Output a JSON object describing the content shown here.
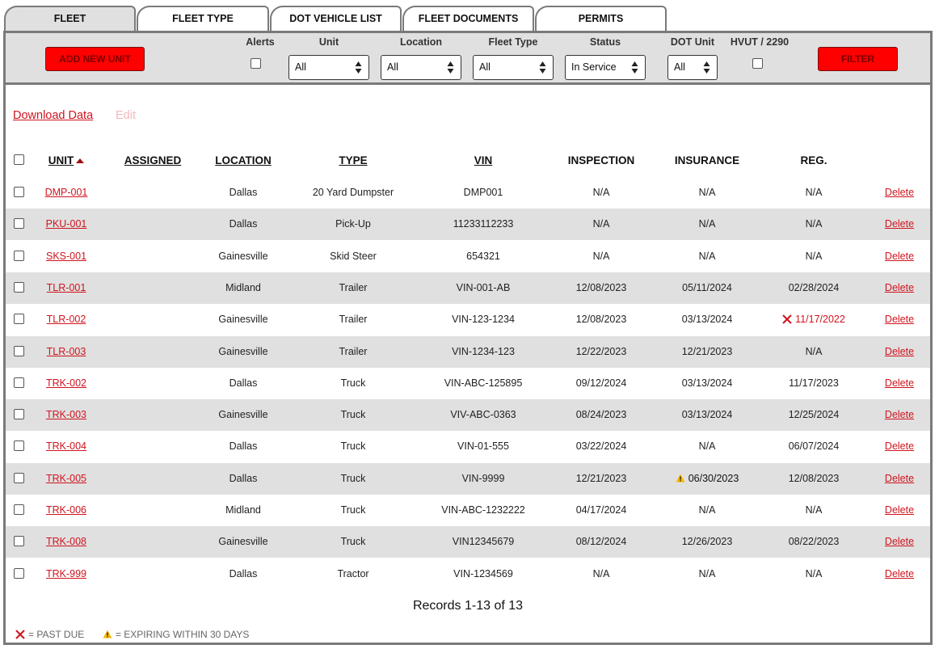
{
  "tabs": [
    {
      "label": "FLEET",
      "active": true
    },
    {
      "label": "FLEET TYPE",
      "active": false
    },
    {
      "label": "DOT VEHICLE LIST",
      "active": false
    },
    {
      "label": "FLEET DOCUMENTS",
      "active": false
    },
    {
      "label": "PERMITS",
      "active": false
    }
  ],
  "filters": {
    "add_button": "ADD NEW UNIT",
    "alerts_label": "Alerts",
    "unit": {
      "label": "Unit",
      "value": "All"
    },
    "location": {
      "label": "Location",
      "value": "All"
    },
    "fleet_type": {
      "label": "Fleet Type",
      "value": "All"
    },
    "status": {
      "label": "Status",
      "value": "In Service"
    },
    "dot_unit": {
      "label": "DOT Unit",
      "value": "All"
    },
    "hvut_label": "HVUT / 2290",
    "filter_button": "FILTER"
  },
  "actions": {
    "download": "Download Data",
    "edit": "Edit"
  },
  "table": {
    "headers": {
      "unit": "UNIT",
      "assigned": "ASSIGNED",
      "location": "LOCATION",
      "type": "TYPE",
      "vin": "VIN",
      "inspection": "INSPECTION",
      "insurance": "INSURANCE",
      "reg": "REG."
    },
    "delete_label": "Delete",
    "rows": [
      {
        "unit": "DMP-001",
        "assigned": "",
        "location": "Dallas",
        "type": "20 Yard Dumpster",
        "vin": "DMP001",
        "inspection": "N/A",
        "insurance": "N/A",
        "reg": "N/A",
        "reg_status": "",
        "insurance_status": ""
      },
      {
        "unit": "PKU-001",
        "assigned": "",
        "location": "Dallas",
        "type": "Pick-Up",
        "vin": "11233112233",
        "inspection": "N/A",
        "insurance": "N/A",
        "reg": "N/A",
        "reg_status": "",
        "insurance_status": ""
      },
      {
        "unit": "SKS-001",
        "assigned": "",
        "location": "Gainesville",
        "type": "Skid Steer",
        "vin": "654321",
        "inspection": "N/A",
        "insurance": "N/A",
        "reg": "N/A",
        "reg_status": "",
        "insurance_status": ""
      },
      {
        "unit": "TLR-001",
        "assigned": "",
        "location": "Midland",
        "type": "Trailer",
        "vin": "VIN-001-AB",
        "inspection": "12/08/2023",
        "insurance": "05/11/2024",
        "reg": "02/28/2024",
        "reg_status": "",
        "insurance_status": ""
      },
      {
        "unit": "TLR-002",
        "assigned": "",
        "location": "Gainesville",
        "type": "Trailer",
        "vin": "VIN-123-1234",
        "inspection": "12/08/2023",
        "insurance": "03/13/2024",
        "reg": "11/17/2022",
        "reg_status": "past-due",
        "insurance_status": ""
      },
      {
        "unit": "TLR-003",
        "assigned": "",
        "location": "Gainesville",
        "type": "Trailer",
        "vin": "VIN-1234-123",
        "inspection": "12/22/2023",
        "insurance": "12/21/2023",
        "reg": "N/A",
        "reg_status": "",
        "insurance_status": ""
      },
      {
        "unit": "TRK-002",
        "assigned": "",
        "location": "Dallas",
        "type": "Truck",
        "vin": "VIN-ABC-125895",
        "inspection": "09/12/2024",
        "insurance": "03/13/2024",
        "reg": "11/17/2023",
        "reg_status": "",
        "insurance_status": ""
      },
      {
        "unit": "TRK-003",
        "assigned": "",
        "location": "Gainesville",
        "type": "Truck",
        "vin": "VIV-ABC-0363",
        "inspection": "08/24/2023",
        "insurance": "03/13/2024",
        "reg": "12/25/2024",
        "reg_status": "",
        "insurance_status": ""
      },
      {
        "unit": "TRK-004",
        "assigned": "",
        "location": "Dallas",
        "type": "Truck",
        "vin": "VIN-01-555",
        "inspection": "03/22/2024",
        "insurance": "N/A",
        "reg": "06/07/2024",
        "reg_status": "",
        "insurance_status": ""
      },
      {
        "unit": "TRK-005",
        "assigned": "",
        "location": "Dallas",
        "type": "Truck",
        "vin": "VIN-9999",
        "inspection": "12/21/2023",
        "insurance": "06/30/2023",
        "reg": "12/08/2023",
        "reg_status": "",
        "insurance_status": "expiring"
      },
      {
        "unit": "TRK-006",
        "assigned": "",
        "location": "Midland",
        "type": "Truck",
        "vin": "VIN-ABC-1232222",
        "inspection": "04/17/2024",
        "insurance": "N/A",
        "reg": "N/A",
        "reg_status": "",
        "insurance_status": ""
      },
      {
        "unit": "TRK-008",
        "assigned": "",
        "location": "Gainesville",
        "type": "Truck",
        "vin": "VIN12345679",
        "inspection": "08/12/2024",
        "insurance": "12/26/2023",
        "reg": "08/22/2023",
        "reg_status": "",
        "insurance_status": ""
      },
      {
        "unit": "TRK-999",
        "assigned": "",
        "location": "Dallas",
        "type": "Tractor",
        "vin": "VIN-1234569",
        "inspection": "N/A",
        "insurance": "N/A",
        "reg": "N/A",
        "reg_status": "",
        "insurance_status": ""
      }
    ]
  },
  "records_text": "Records 1-13 of 13",
  "legend": {
    "past_due": "= PAST DUE",
    "expiring": "= EXPIRING WITHIN 30 DAYS"
  },
  "colors": {
    "accent_red": "#ff0000",
    "link_red": "#d0141e",
    "warning_yellow": "#f5b800"
  }
}
